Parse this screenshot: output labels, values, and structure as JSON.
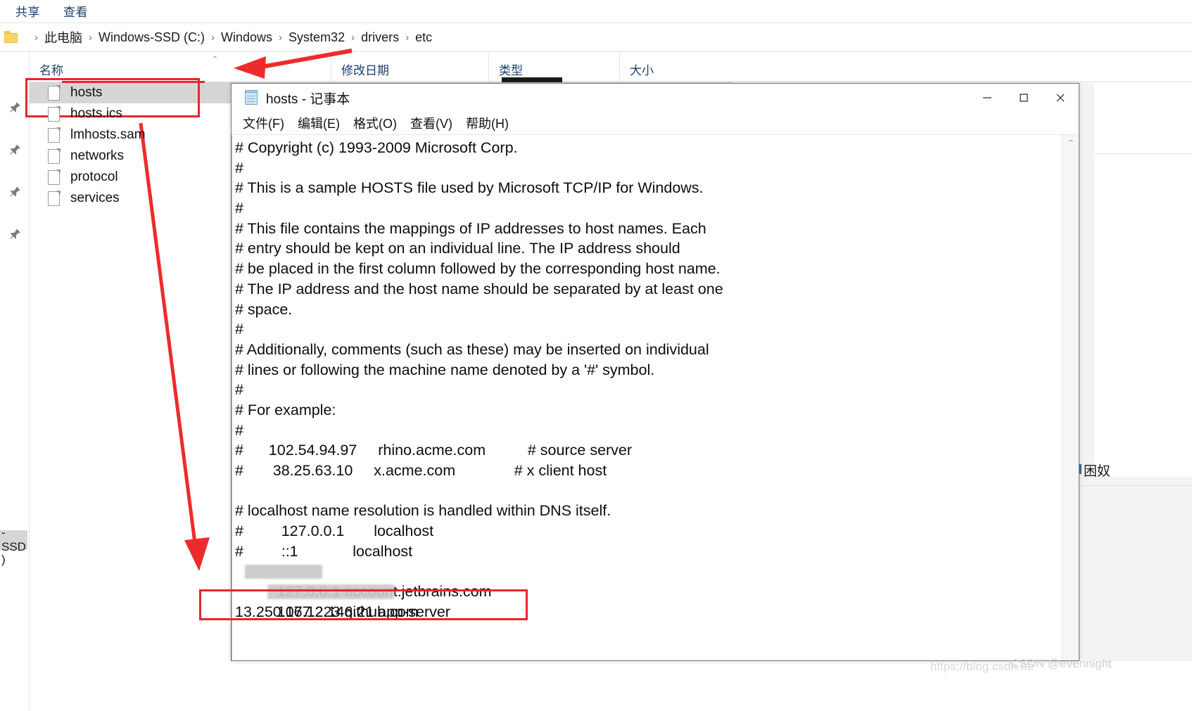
{
  "explorer": {
    "ribbon_tabs": [
      "共享",
      "查看"
    ],
    "breadcrumb": [
      "此电脑",
      "Windows-SSD (C:)",
      "Windows",
      "System32",
      "drivers",
      "etc"
    ],
    "breadcrumb_separator": "›",
    "columns": [
      "名称",
      "修改日期",
      "类型",
      "大小"
    ],
    "sort_caret": "⌃",
    "files": [
      {
        "name": "hosts",
        "selected": true
      },
      {
        "name": "hosts.ics",
        "selected": false
      },
      {
        "name": "lmhosts.sam",
        "selected": false
      },
      {
        "name": "networks",
        "selected": false
      },
      {
        "name": "protocol",
        "selected": false
      },
      {
        "name": "services",
        "selected": false
      }
    ],
    "nav_fragments": {
      "ssd_chip": "-SSD",
      "paren": ")"
    }
  },
  "notepad": {
    "title": "hosts - 记事本",
    "menu": [
      "文件(F)",
      "编辑(E)",
      "格式(O)",
      "查看(V)",
      "帮助(H)"
    ],
    "window_buttons": [
      "minimize",
      "maximize",
      "close"
    ],
    "content_lines": [
      "# Copyright (c) 1993-2009 Microsoft Corp.",
      "#",
      "# This is a sample HOSTS file used by Microsoft TCP/IP for Windows.",
      "#",
      "# This file contains the mappings of IP addresses to host names. Each",
      "# entry should be kept on an individual line. The IP address should",
      "# be placed in the first column followed by the corresponding host name.",
      "# The IP address and the host name should be separated by at least one",
      "# space.",
      "#",
      "# Additionally, comments (such as these) may be inserted on individual",
      "# lines or following the machine name denoted by a '#' symbol.",
      "#",
      "# For example:",
      "#",
      "#      102.54.94.97     rhino.acme.com          # source server",
      "#       38.25.63.10     x.acme.com              # x client host",
      "",
      "# localhost name resolution is handled within DNS itself.",
      "#         127.0.0.1       localhost",
      "#         ::1             localhost",
      "127.0.0.1 account.jetbrains.com",
      "106.12.146.21 app-server",
      "13.250.177.223 github.com"
    ],
    "blurred_line_indices": [
      21,
      22
    ],
    "highlighted_line_index": 23
  },
  "annotations": {
    "box_color": "#e8262a",
    "arrow_color": "#ee2b2b",
    "boxes": [
      "hosts-file-row",
      "github-hosts-line"
    ],
    "arrows": [
      "arrow-to-hosts-file",
      "arrow-hosts-to-github-line"
    ]
  },
  "background_fragments": {
    "right_text": "困奴"
  },
  "watermark": {
    "url": "https://blog.csdn.ne",
    "tag": "CSDN @evennight"
  }
}
